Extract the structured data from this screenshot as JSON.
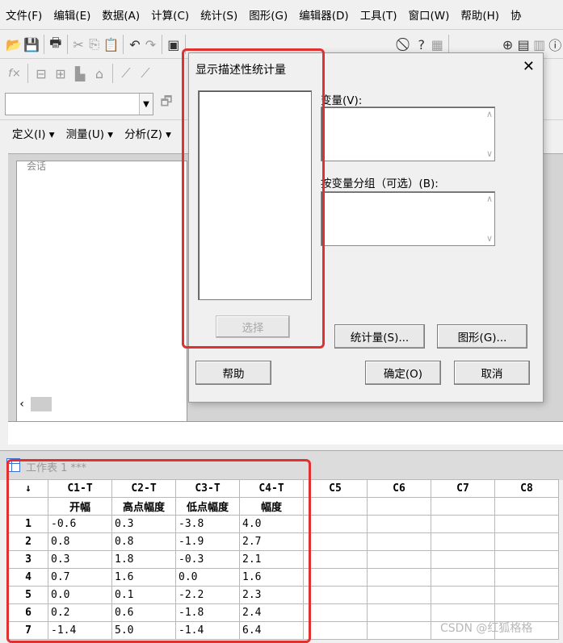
{
  "menubar": {
    "items": [
      "文件(F)",
      "编辑(E)",
      "数据(A)",
      "计算(C)",
      "统计(S)",
      "图形(G)",
      "编辑器(D)",
      "工具(T)",
      "窗口(W)",
      "帮助(H)",
      "协"
    ]
  },
  "toolbar3": {
    "items": [
      "定义(I)",
      "测量(U)",
      "分析(Z)"
    ]
  },
  "session": {
    "title": "会话"
  },
  "dialog": {
    "title": "显示描述性统计量",
    "close": "✕",
    "variables_label": "变量(V):",
    "by_variable_label": "按变量分组（可选）(B):",
    "select_button": "选择",
    "statistics_button": "统计量(S)...",
    "graphs_button": "图形(G)...",
    "help_button": "帮助",
    "ok_button": "确定(O)",
    "cancel_button": "取消"
  },
  "worksheet": {
    "title": "工作表 1 ***",
    "corner": "↓",
    "columns": [
      "C1-T",
      "C2-T",
      "C3-T",
      "C4-T",
      "C5",
      "C6",
      "C7",
      "C8"
    ],
    "names": [
      "开幅",
      "高点幅度",
      "低点幅度",
      "幅度",
      "",
      "",
      "",
      ""
    ],
    "rows": [
      {
        "n": "1",
        "v": [
          "-0.6",
          "0.3",
          "-3.8",
          "4.0"
        ]
      },
      {
        "n": "2",
        "v": [
          "0.8",
          "0.8",
          "-1.9",
          "2.7"
        ]
      },
      {
        "n": "3",
        "v": [
          "0.3",
          "1.8",
          "-0.3",
          "2.1"
        ]
      },
      {
        "n": "4",
        "v": [
          "0.7",
          "1.6",
          "0.0",
          "1.6"
        ]
      },
      {
        "n": "5",
        "v": [
          "0.0",
          "0.1",
          "-2.2",
          "2.3"
        ]
      },
      {
        "n": "6",
        "v": [
          "0.2",
          "0.6",
          "-1.8",
          "2.4"
        ]
      },
      {
        "n": "7",
        "v": [
          "-1.4",
          "5.0",
          "-1.4",
          "6.4"
        ]
      }
    ]
  },
  "watermark": "CSDN @红狐格格",
  "colors": {
    "highlight": "#e03030",
    "accent": "#3b6fd0"
  }
}
